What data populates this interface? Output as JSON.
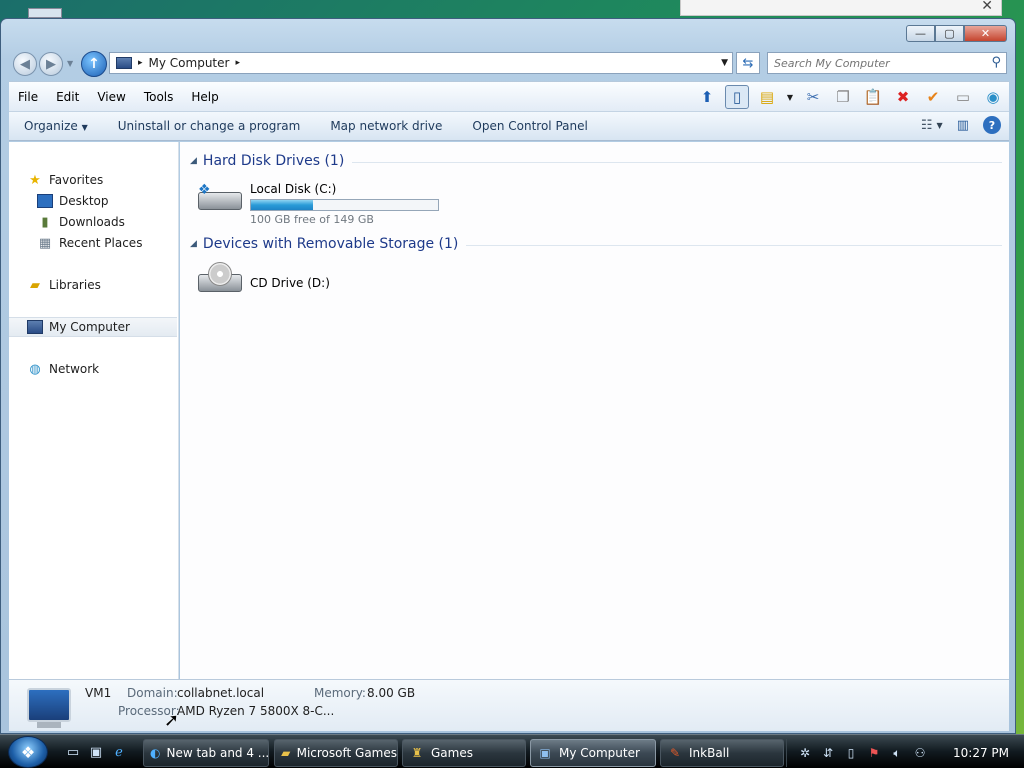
{
  "window": {
    "caption_buttons": {
      "minimize": "—",
      "maximize": "▢",
      "close": "✕"
    }
  },
  "address_bar": {
    "path": "My Computer",
    "separator": "▸",
    "search_placeholder": "Search My Computer"
  },
  "menu": [
    "File",
    "Edit",
    "View",
    "Tools",
    "Help"
  ],
  "command_bar": {
    "organize": "Organize",
    "uninstall": "Uninstall or change a program",
    "map_drive": "Map network drive",
    "control_panel": "Open Control Panel"
  },
  "nav": {
    "favorites": "Favorites",
    "desktop": "Desktop",
    "downloads": "Downloads",
    "recent": "Recent Places",
    "libraries": "Libraries",
    "my_computer": "My Computer",
    "network": "Network"
  },
  "groups": {
    "hdd": "Hard Disk Drives (1)",
    "removable": "Devices with Removable Storage (1)"
  },
  "drives": {
    "c": {
      "name": "Local Disk (C:)",
      "free": "100 GB free of 149 GB",
      "used_fraction": 0.33
    },
    "d": {
      "name": "CD Drive (D:)"
    }
  },
  "details": {
    "computer_name": "VM1",
    "domain_label": "Domain:",
    "domain": "collabnet.local",
    "memory_label": "Memory:",
    "memory": "8.00 GB",
    "processor_label": "Processor:",
    "processor": "AMD Ryzen 7 5800X 8-C..."
  },
  "taskbar": {
    "tasks": [
      "New tab and 4 ...",
      "Microsoft Games",
      "Games",
      "My Computer",
      "InkBall"
    ],
    "clock": "10:27 PM"
  },
  "colors": {
    "accent": "#1e3a8a",
    "bar_fill": "#2a9bd8"
  }
}
